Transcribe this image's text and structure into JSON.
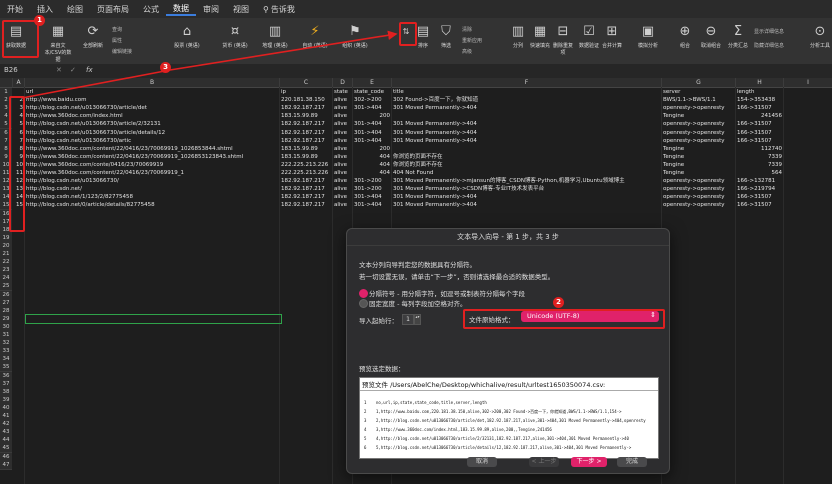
{
  "menu": [
    "开始",
    "插入",
    "绘图",
    "页面布局",
    "公式",
    "数据",
    "审阅",
    "视图",
    "告诉我"
  ],
  "active_menu": "数据",
  "ribbon": {
    "get_data": "获取数据",
    "from_text": "来自文本/CSV的数据",
    "refresh_all": "全部刷新",
    "queries": "查询",
    "properties": "属性",
    "edit_links": "编辑链接",
    "stocks": "股票 (英语)",
    "currencies": "货币 (英语)",
    "geography": "地理 (英语)",
    "auto_detect": "自动 (英语)",
    "organization": "组织 (英语)",
    "sort": "排序",
    "filter": "筛选",
    "clear": "清除",
    "reapply": "重新应用",
    "advanced": "高级",
    "text_to_columns": "分列",
    "flash_fill": "快速填充",
    "remove_duplicates": "删除重复项",
    "data_validation": "数据验证",
    "consolidate": "合并计算",
    "what_if": "模拟分析",
    "group": "组合",
    "ungroup": "取消组合",
    "subtotal": "分类汇总",
    "show_detail": "显示详细信息",
    "hide_detail": "隐藏详细信息",
    "analysis": "分析工具"
  },
  "formula_bar": {
    "cell_ref": "B26",
    "fx": "fx"
  },
  "columns": [
    "A",
    "B",
    "C",
    "D",
    "E",
    "F",
    "G",
    "H",
    "I"
  ],
  "rows": [
    {
      "n": "1",
      "b": "url",
      "c": "ip",
      "d": "state",
      "e": "state_code",
      "f": "title",
      "g": "server",
      "h": "length"
    },
    {
      "n": "2",
      "b": "http://www.baidu.com",
      "c": "220.181.38.150",
      "d": "alive",
      "e": "302->200",
      "f": "302 Found->百度一下，你就知道",
      "g": "BWS/1.1->BWS/1.1",
      "h": "154->353438"
    },
    {
      "n": "3",
      "b": "http://blog.csdn.net/u013066730/article/det",
      "c": "182.92.187.217",
      "d": "alive",
      "e": "301->404",
      "f": "301 Moved Permanently->404",
      "g": "openresty->openresty",
      "h": "166->31507"
    },
    {
      "n": "4",
      "b": "http://www.360doc.com/index.html",
      "c": "183.15.99.89",
      "d": "alive",
      "e": "200",
      "f": "",
      "g": "Tengine",
      "h": "241456"
    },
    {
      "n": "5",
      "b": "http://blog.csdn.net/u013066730/article/2/32131",
      "c": "182.92.187.217",
      "d": "alive",
      "e": "301->404",
      "f": "301 Moved Permanently->404",
      "g": "openresty->openresty",
      "h": "166->31507"
    },
    {
      "n": "6",
      "b": "http://blog.csdn.net/u013066730/article/details/12",
      "c": "182.92.187.217",
      "d": "alive",
      "e": "301->404",
      "f": "301 Moved Permanently->404",
      "g": "openresty->openresty",
      "h": "166->31507"
    },
    {
      "n": "7",
      "b": "http://blog.csdn.net/u013066730/artic",
      "c": "182.92.187.217",
      "d": "alive",
      "e": "301->404",
      "f": "301 Moved Permanently->404",
      "g": "openresty->openresty",
      "h": "166->31507"
    },
    {
      "n": "8",
      "b": "http://www.360doc.com/content/22/0416/23/7006991​9_1026853844.shtml",
      "c": "183.15.99.89",
      "d": "alive",
      "e": "200",
      "f": "",
      "g": "Tengine",
      "h": "112740"
    },
    {
      "n": "9",
      "b": "http://www.360doc.com/content/22/0416/23/7006991​9_1026853123843.shtml",
      "c": "183.15.99.89",
      "d": "alive",
      "e": "404",
      "f": "你浏览的页面不存在",
      "g": "Tengine",
      "h": "7339"
    },
    {
      "n": "10",
      "b": "http://www.360doc.com/conte/0416/23/70069919",
      "c": "222.225.213.226",
      "d": "alive",
      "e": "404",
      "f": "你浏览的页面不存在",
      "g": "Tengine",
      "h": "7339"
    },
    {
      "n": "11",
      "b": "http://www.360doc.com/content/22/0416/23/700699​19_1",
      "c": "222.225.213.226",
      "d": "alive",
      "e": "404",
      "f": "404 Not Found",
      "g": "Tengine",
      "h": "564"
    },
    {
      "n": "12",
      "b": "http://blog.csdn.net/u013066730/",
      "c": "182.92.187.217",
      "d": "alive",
      "e": "301->200",
      "f": "301 Moved Permanently->mjansun的博客_CSDN博客-Python,机器学习,Ubuntu领域博主",
      "g": "openresty->openresty",
      "h": "166->132781"
    },
    {
      "n": "13",
      "b": "http://blog.csdn.net/",
      "c": "182.92.187.217",
      "d": "alive",
      "e": "301->200",
      "f": "301 Moved Permanently->CSDN博客-专业IT技术发表平台",
      "g": "openresty->openresty",
      "h": "166->219794"
    },
    {
      "n": "14",
      "b": "http://blog.csdn.net/1/123/2/82775458",
      "c": "182.92.187.217",
      "d": "alive",
      "e": "301->404",
      "f": "301 Moved Permanently->404",
      "g": "openresty->openresty",
      "h": "166->31507"
    },
    {
      "n": "15",
      "b": "http://blog.csdn.net/0/article/details/82775458",
      "c": "182.92.187.217",
      "d": "alive",
      "e": "301->404",
      "f": "301 Moved Permanently->404",
      "g": "openresty->openresty",
      "h": "166->31507"
    }
  ],
  "empty_rows": [
    "16",
    "17",
    "18",
    "19",
    "20",
    "21",
    "22",
    "23",
    "24",
    "25",
    "26",
    "27",
    "28",
    "29",
    "30",
    "31",
    "32",
    "33",
    "34",
    "35",
    "36",
    "37",
    "38",
    "39",
    "40",
    "41",
    "42",
    "43",
    "44",
    "45",
    "46",
    "47"
  ],
  "dialog": {
    "title": "文本导入向导 - 第 1 步，共 3 步",
    "line1": "文本分列向导判定您的数据具有分隔符。",
    "line2": "若一切设置无误，请单击“下一步”，否则请选择最合适的数据类型。",
    "opt1": "分隔符号 - 用分隔字符，如逗号或制表符分隔每个字段",
    "opt2": "固定宽度 - 每列字段加空格对齐。",
    "start_row_label": "导入起始行：",
    "start_row_value": "1",
    "encoding_label": "文件原始格式：",
    "encoding_value": "Unicode (UTF-8)",
    "preview_label": "预览选定数据：",
    "preview_file": "预览文件 /Users/AbelChe/Desktop/whichalive/result/urltest1650350074.csv:",
    "preview_lines": [
      "no,url,ip,state,state_code,title,server,length",
      "1,http://www.baidu.com,220.181.38.150,alive,302->200,302 Found->百度一下，你就知道,BWS/1.1->BWS/1.1,154->",
      "2,http://blog.csdn.net/u013066730/article/det,182.92.187.217,alive,301->404,301 Moved Permanently->404,openresty",
      "3,http://www.360doc.com/index.html,183.15.99.89,alive,200,,Tengine,241456",
      "4,http://blog.csdn.net/u013066730/article/2/32131,182.92.187.217,alive,301->404,301 Moved Permanently->40",
      "5,http://blog.csdn.net/u013066730/article/details/12,182.92.187.217,alive,301->404,301 Moved Permanently->"
    ],
    "btn_cancel": "取消",
    "btn_back": "< 上一步",
    "btn_next": "下一步 >",
    "btn_finish": "完成"
  },
  "annotations": {
    "b1": "1",
    "b2": "2",
    "b3": "3"
  },
  "colors": {
    "accent": "#3b7ddd",
    "annotation": "#e02020",
    "next_button": "#e0226a"
  }
}
